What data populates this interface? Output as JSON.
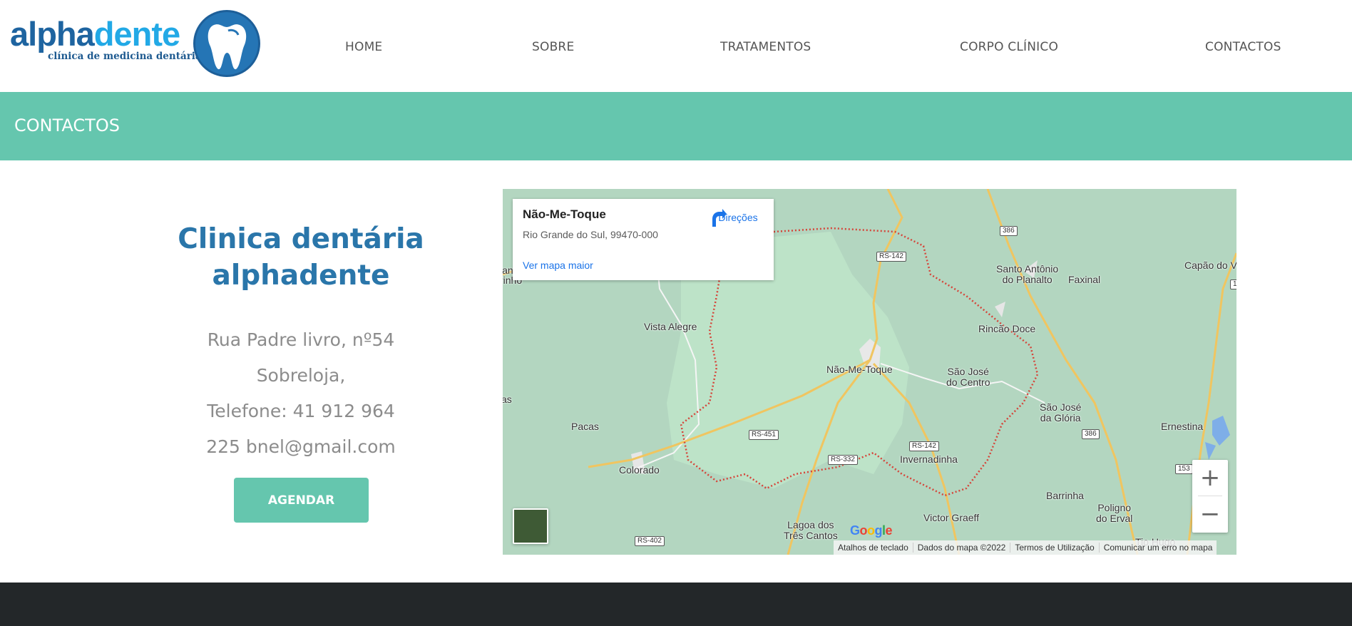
{
  "logo": {
    "word_part1": "alpha",
    "word_part2": "dente",
    "tagline": "clínica de medicina dentária",
    "tooth_icon": "tooth-icon",
    "colors": {
      "dark_blue": "#1e64a0",
      "light_blue": "#22a9e6"
    }
  },
  "nav": {
    "items": [
      {
        "label": "HOME"
      },
      {
        "label": "SOBRE"
      },
      {
        "label": "TRATAMENTOS"
      },
      {
        "label": "CORPO CLÍNICO"
      },
      {
        "label": "CONTACTOS"
      }
    ]
  },
  "banner": {
    "title": "CONTACTOS",
    "color": "#65c6ae"
  },
  "contact": {
    "clinic_name_line1": "Clinica dentária",
    "clinic_name_line2": "alphadente",
    "address": "Rua Padre livro, nº54",
    "address2": "Sobreloja,",
    "phone": "Telefone: 41 912 964",
    "email": "225 bnel@gmail.com",
    "button_label": "AGENDAR"
  },
  "map": {
    "place_name": "Não-Me-Toque",
    "place_address": "Rio Grande do Sul, 99470-000",
    "larger_map_link": "Ver mapa maior",
    "directions_label": "Direções",
    "directions_icon": "directions-icon",
    "labels": {
      "vista_alegre": "Vista Alegre",
      "nao_me_toque": "Não-Me-Toque",
      "sao_jose_centro_1": "São José",
      "sao_jose_centro_2": "do Centro",
      "sao_jose_gloria_1": "São José",
      "sao_jose_gloria_2": "da Glória",
      "santo_antonio_1": "Santo Antônio",
      "santo_antonio_2": "do Planalto",
      "faxinal": "Faxinal",
      "capao": "Capão do V",
      "rincao_doce": "Rincão Doce",
      "pacas": "Pacas",
      "colorado": "Colorado",
      "invernadinha": "Invernadinha",
      "ernestina": "Ernestina",
      "barrinha": "Barrinha",
      "poligono_1": "Poligno",
      "poligono_2": "do Erval",
      "victor_graeff": "Victor Graeff",
      "lagoa_1": "Lagoa dos",
      "lagoa_2": "Três Cantos",
      "tio_hugo": "Tio Hugo",
      "left_partial_1": "lan",
      "left_partial_2": "rinho",
      "left_partial_3": "as"
    },
    "roads": {
      "rs142_top": "RS-142",
      "r386_top": "386",
      "rs451": "RS-451",
      "rs332": "RS-332",
      "rs142_bottom": "RS-142",
      "r386_bottom": "386",
      "r153": "153",
      "rs402": "RS-402",
      "r1": "1"
    },
    "zoom_in": "+",
    "zoom_out": "−",
    "google_logo": "Google",
    "attribution": [
      "Atalhos de teclado",
      "Dados do mapa ©2022",
      "Termos de Utilização",
      "Comunicar um erro no mapa"
    ]
  }
}
